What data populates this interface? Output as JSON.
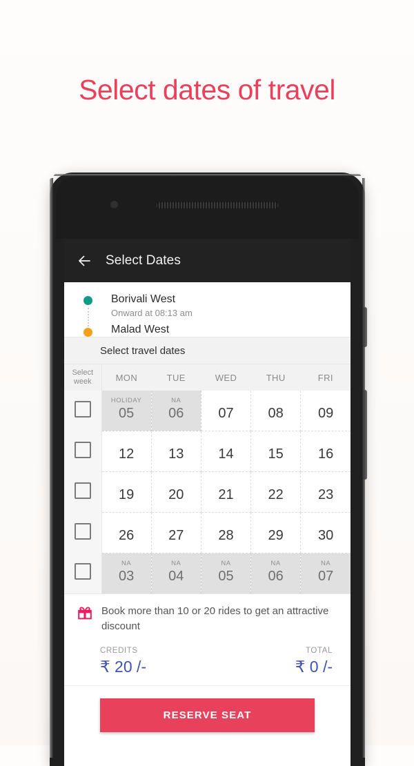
{
  "promo": {
    "title": "Select dates of travel",
    "accent_color": "#E8415B"
  },
  "appbar": {
    "back_icon": "arrow-left-icon",
    "title": "Select Dates"
  },
  "route": {
    "from": "Borivali West",
    "time": "Onward at 08:13 am",
    "to": "Malad West",
    "start_dot_color": "#0C9C86",
    "end_dot_color": "#F3A01C"
  },
  "calendar": {
    "section_title": "Select travel dates",
    "week_column_header_line1": "Select",
    "week_column_header_line2": "week",
    "day_headers": [
      "MON",
      "TUE",
      "WED",
      "THU",
      "FRI"
    ],
    "rows": [
      {
        "checkbox_checked": false,
        "days": [
          {
            "num": "05",
            "tag": "HOLIDAY",
            "disabled": true
          },
          {
            "num": "06",
            "tag": "NA",
            "disabled": true
          },
          {
            "num": "07",
            "tag": "",
            "disabled": false
          },
          {
            "num": "08",
            "tag": "",
            "disabled": false
          },
          {
            "num": "09",
            "tag": "",
            "disabled": false
          }
        ]
      },
      {
        "checkbox_checked": false,
        "days": [
          {
            "num": "12",
            "tag": "",
            "disabled": false
          },
          {
            "num": "13",
            "tag": "",
            "disabled": false
          },
          {
            "num": "14",
            "tag": "",
            "disabled": false
          },
          {
            "num": "15",
            "tag": "",
            "disabled": false
          },
          {
            "num": "16",
            "tag": "",
            "disabled": false
          }
        ]
      },
      {
        "checkbox_checked": false,
        "days": [
          {
            "num": "19",
            "tag": "",
            "disabled": false
          },
          {
            "num": "20",
            "tag": "",
            "disabled": false
          },
          {
            "num": "21",
            "tag": "",
            "disabled": false
          },
          {
            "num": "22",
            "tag": "",
            "disabled": false
          },
          {
            "num": "23",
            "tag": "",
            "disabled": false
          }
        ]
      },
      {
        "checkbox_checked": false,
        "days": [
          {
            "num": "26",
            "tag": "",
            "disabled": false
          },
          {
            "num": "27",
            "tag": "",
            "disabled": false
          },
          {
            "num": "28",
            "tag": "",
            "disabled": false
          },
          {
            "num": "29",
            "tag": "",
            "disabled": false
          },
          {
            "num": "30",
            "tag": "",
            "disabled": false
          }
        ]
      },
      {
        "checkbox_checked": false,
        "days": [
          {
            "num": "03",
            "tag": "NA",
            "disabled": true
          },
          {
            "num": "04",
            "tag": "NA",
            "disabled": true
          },
          {
            "num": "05",
            "tag": "NA",
            "disabled": true
          },
          {
            "num": "06",
            "tag": "NA",
            "disabled": true
          },
          {
            "num": "07",
            "tag": "NA",
            "disabled": true
          }
        ]
      }
    ]
  },
  "offer": {
    "icon": "gift-icon",
    "icon_color": "#EC1C63",
    "text": "Book more than 10 or 20 rides to get an attractive discount"
  },
  "summary": {
    "credits_label": "CREDITS",
    "credits_value": "₹ 20 /-",
    "total_label": "TOTAL",
    "total_value": "₹ 0 /-",
    "value_color": "#3F51B5"
  },
  "cta": {
    "label": "RESERVE SEAT",
    "color": "#E8415B"
  }
}
